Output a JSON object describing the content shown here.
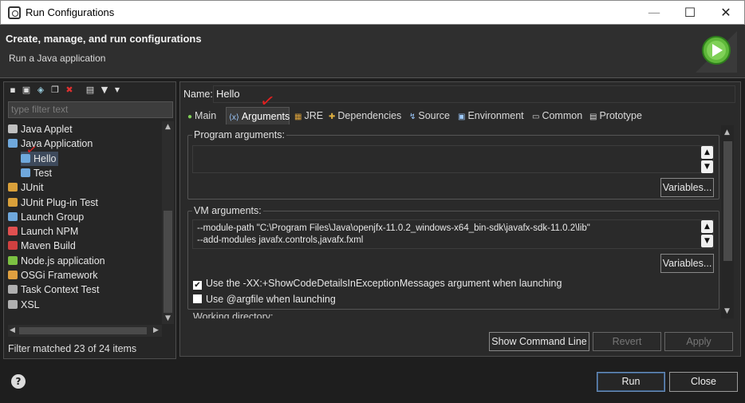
{
  "window": {
    "title": "Run Configurations",
    "minimize": "—",
    "maximize": "☐",
    "close": "✕"
  },
  "header": {
    "title": "Create, manage, and run configurations",
    "subtitle": "Run a Java application"
  },
  "sidebar": {
    "filter_placeholder": "type filter text",
    "items": [
      {
        "label": "Java Applet",
        "color": "#c0c0c0"
      },
      {
        "label": "Java Application",
        "color": "#6fa8dc"
      },
      {
        "label": "Hello",
        "color": "#6fa8dc"
      },
      {
        "label": "Test",
        "color": "#6fa8dc"
      },
      {
        "label": "JUnit",
        "color": "#d9a03a"
      },
      {
        "label": "JUnit Plug-in Test",
        "color": "#d9a03a"
      },
      {
        "label": "Launch Group",
        "color": "#6fa8dc"
      },
      {
        "label": "Launch NPM",
        "color": "#e05050"
      },
      {
        "label": "Maven Build",
        "color": "#d04040"
      },
      {
        "label": "Node.js application",
        "color": "#7cc142"
      },
      {
        "label": "OSGi Framework",
        "color": "#e0a040"
      },
      {
        "label": "Task Context Test",
        "color": "#b0b0b0"
      },
      {
        "label": "XSL",
        "color": "#b0b0b0"
      }
    ],
    "status": "Filter matched 23 of 24 items"
  },
  "main": {
    "name_label": "Name:",
    "name_value": "Hello",
    "tabs": [
      "Main",
      "Arguments",
      "JRE",
      "Dependencies",
      "Source",
      "Environment",
      "Common",
      "Prototype"
    ],
    "program_args": {
      "label": "Program arguments:",
      "value": "",
      "variables": "Variables..."
    },
    "vm_args": {
      "label": "VM arguments:",
      "line1": "--module-path \"C:\\Program Files\\Java\\openjfx-11.0.2_windows-x64_bin-sdk\\javafx-sdk-11.0.2\\lib\"",
      "line2": "--add-modules javafx.controls,javafx.fxml",
      "variables": "Variables..."
    },
    "show_code_details": {
      "label": "Use the -XX:+ShowCodeDetailsInExceptionMessages argument when launching",
      "checked": true
    },
    "argfile": {
      "label": "Use @argfile when launching",
      "checked": false
    },
    "working_dir_label": "Working directory:",
    "show_command_line": "Show Command Line",
    "revert": "Revert",
    "apply": "Apply"
  },
  "footer": {
    "help": "?",
    "run": "Run",
    "close": "Close"
  }
}
